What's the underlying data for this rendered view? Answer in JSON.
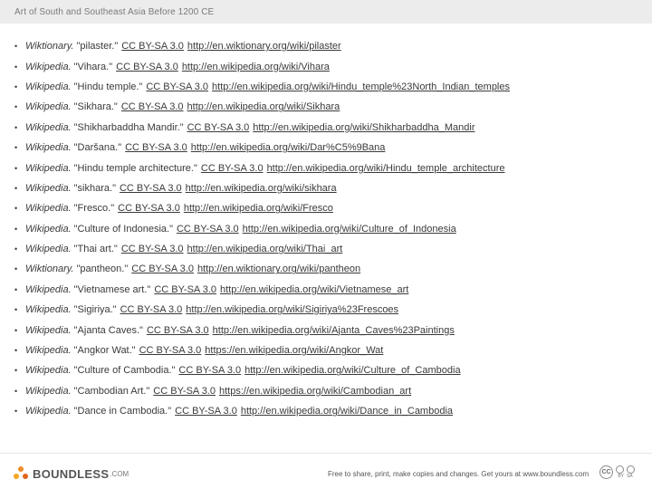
{
  "header": {
    "title": "Art of South and Southeast Asia Before 1200 CE"
  },
  "references": [
    {
      "source": "Wiktionary.",
      "title": "\"pilaster.\"",
      "license": "CC BY-SA 3.0",
      "url": "http://en.wiktionary.org/wiki/pilaster"
    },
    {
      "source": "Wikipedia.",
      "title": "\"Vihara.\"",
      "license": "CC BY-SA 3.0",
      "url": "http://en.wikipedia.org/wiki/Vihara"
    },
    {
      "source": "Wikipedia.",
      "title": "\"Hindu temple.\"",
      "license": "CC BY-SA 3.0",
      "url": "http://en.wikipedia.org/wiki/Hindu_temple%23North_Indian_temples"
    },
    {
      "source": "Wikipedia.",
      "title": "\"Sikhara.\"",
      "license": "CC BY-SA 3.0",
      "url": "http://en.wikipedia.org/wiki/Sikhara"
    },
    {
      "source": "Wikipedia.",
      "title": "\"Shikharbaddha Mandir.\"",
      "license": "CC BY-SA 3.0",
      "url": "http://en.wikipedia.org/wiki/Shikharbaddha_Mandir"
    },
    {
      "source": "Wikipedia.",
      "title": "\"Daršana.\"",
      "license": "CC BY-SA 3.0",
      "url": "http://en.wikipedia.org/wiki/Dar%C5%9Bana"
    },
    {
      "source": "Wikipedia.",
      "title": "\"Hindu temple architecture.\"",
      "license": "CC BY-SA 3.0",
      "url": "http://en.wikipedia.org/wiki/Hindu_temple_architecture"
    },
    {
      "source": "Wikipedia.",
      "title": "\"sikhara.\"",
      "license": "CC BY-SA 3.0",
      "url": "http://en.wikipedia.org/wiki/sikhara"
    },
    {
      "source": "Wikipedia.",
      "title": "\"Fresco.\"",
      "license": "CC BY-SA 3.0",
      "url": "http://en.wikipedia.org/wiki/Fresco"
    },
    {
      "source": "Wikipedia.",
      "title": "\"Culture of Indonesia.\"",
      "license": "CC BY-SA 3.0",
      "url": "http://en.wikipedia.org/wiki/Culture_of_Indonesia"
    },
    {
      "source": "Wikipedia.",
      "title": "\"Thai art.\"",
      "license": "CC BY-SA 3.0",
      "url": "http://en.wikipedia.org/wiki/Thai_art"
    },
    {
      "source": "Wiktionary.",
      "title": "\"pantheon.\"",
      "license": "CC BY-SA 3.0",
      "url": "http://en.wiktionary.org/wiki/pantheon"
    },
    {
      "source": "Wikipedia.",
      "title": "\"Vietnamese art.\"",
      "license": "CC BY-SA 3.0",
      "url": "http://en.wikipedia.org/wiki/Vietnamese_art"
    },
    {
      "source": "Wikipedia.",
      "title": "\"Sigiriya.\"",
      "license": "CC BY-SA 3.0",
      "url": "http://en.wikipedia.org/wiki/Sigiriya%23Frescoes"
    },
    {
      "source": "Wikipedia.",
      "title": "\"Ajanta Caves.\"",
      "license": "CC BY-SA 3.0",
      "url": "http://en.wikipedia.org/wiki/Ajanta_Caves%23Paintings"
    },
    {
      "source": "Wikipedia.",
      "title": "\"Angkor Wat.\"",
      "license": "CC BY-SA 3.0",
      "url": "https://en.wikipedia.org/wiki/Angkor_Wat"
    },
    {
      "source": "Wikipedia.",
      "title": "\"Culture of Cambodia.\"",
      "license": "CC BY-SA 3.0",
      "url": "http://en.wikipedia.org/wiki/Culture_of_Cambodia"
    },
    {
      "source": "Wikipedia.",
      "title": "\"Cambodian Art.\"",
      "license": "CC BY-SA 3.0",
      "url": "https://en.wikipedia.org/wiki/Cambodian_art"
    },
    {
      "source": "Wikipedia.",
      "title": "\"Dance in Cambodia.\"",
      "license": "CC BY-SA 3.0",
      "url": "http://en.wikipedia.org/wiki/Dance_in_Cambodia"
    }
  ],
  "footer": {
    "logo_text": "BOUNDLESS",
    "logo_suffix": ".COM",
    "notice": "Free to share, print, make copies and changes. Get yours at www.boundless.com",
    "cc_label": "CC",
    "cc_by": "BY",
    "cc_sa": "SA",
    "logo_color": "#f28c28"
  }
}
